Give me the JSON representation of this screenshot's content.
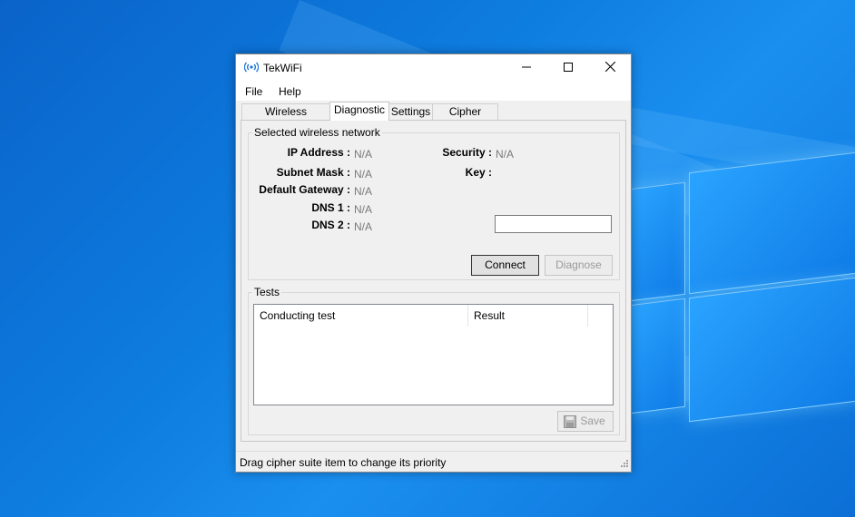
{
  "window": {
    "title": "TekWiFi",
    "minimize_icon": "minimize-icon",
    "maximize_icon": "maximize-icon",
    "close_icon": "close-icon"
  },
  "menu": {
    "items": [
      "File",
      "Help"
    ]
  },
  "tabs": [
    {
      "label": "Wireless Networks"
    },
    {
      "label": "Diagnostic"
    },
    {
      "label": "Settings"
    },
    {
      "label": "Cipher Suites"
    }
  ],
  "selected_network": {
    "group_title": "Selected wireless network",
    "ip_label": "IP Address :",
    "ip_value": "N/A",
    "subnet_label": "Subnet Mask :",
    "subnet_value": "N/A",
    "gateway_label": "Default Gateway :",
    "gateway_value": "N/A",
    "dns1_label": "DNS 1 :",
    "dns1_value": "N/A",
    "dns2_label": "DNS 2 :",
    "dns2_value": "N/A",
    "security_label": "Security :",
    "security_value": "N/A",
    "key_label": "Key :",
    "key_value": "",
    "connect_label": "Connect",
    "diagnose_label": "Diagnose"
  },
  "tests": {
    "group_title": "Tests",
    "columns": [
      "Conducting test",
      "Result"
    ],
    "save_label": "Save",
    "save_icon": "floppy-disk-icon"
  },
  "status": {
    "text": "Drag cipher suite item to change its priority"
  },
  "colors": {
    "desktop": "#0e7de0",
    "window_bg": "#f0f0f0",
    "disabled_text": "#9a9a9a"
  }
}
